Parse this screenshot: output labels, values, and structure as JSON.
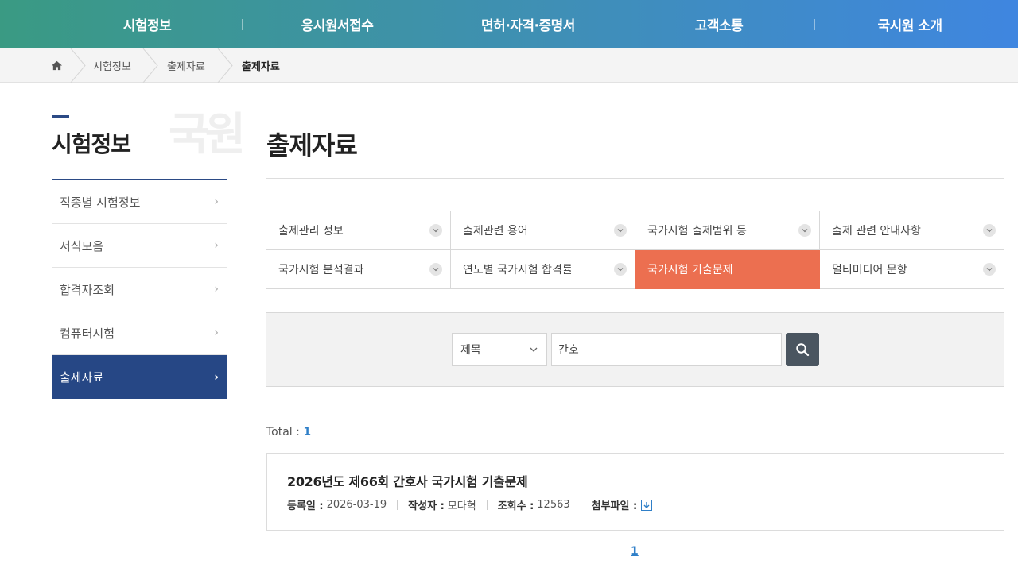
{
  "topnav": {
    "items": [
      "시험정보",
      "응시원서접수",
      "면허·자격·증명서",
      "고객소통",
      "국시원 소개"
    ]
  },
  "breadcrumb": {
    "items": [
      "시험정보",
      "출제자료",
      "출제자료"
    ]
  },
  "sidebar": {
    "title": "시험정보",
    "watermark": "국원",
    "items": [
      {
        "label": "직종별 시험정보"
      },
      {
        "label": "서식모음"
      },
      {
        "label": "합격자조회"
      },
      {
        "label": "컴퓨터시험"
      },
      {
        "label": "출제자료"
      }
    ]
  },
  "main": {
    "title": "출제자료",
    "tabs": [
      {
        "label": "출제관리 정보"
      },
      {
        "label": "출제관련 용어"
      },
      {
        "label": "국가시험 출제범위 등"
      },
      {
        "label": "출제 관련 안내사항"
      },
      {
        "label": "국가시험 분석결과"
      },
      {
        "label": "연도별 국가시험 합격률"
      },
      {
        "label": "국가시험 기출문제"
      },
      {
        "label": "멀티미디어 문항"
      }
    ],
    "search": {
      "field_selected": "제목",
      "query": "간호"
    },
    "total_label": "Total :",
    "total_count": "1",
    "results": [
      {
        "title": "2026년도 제66회 간호사 국가시험 기출문제",
        "date_label": "등록일 :",
        "date": "2026-03-19",
        "author_label": "작성자 :",
        "author": "모다혁",
        "views_label": "조회수 :",
        "views": "12563",
        "file_label": "첨부파일 :"
      }
    ],
    "pager": {
      "current": "1"
    }
  },
  "colors": {
    "accent_navy": "#264785",
    "active_tab": "#ec6f50",
    "link_blue": "#2f7fc8"
  }
}
